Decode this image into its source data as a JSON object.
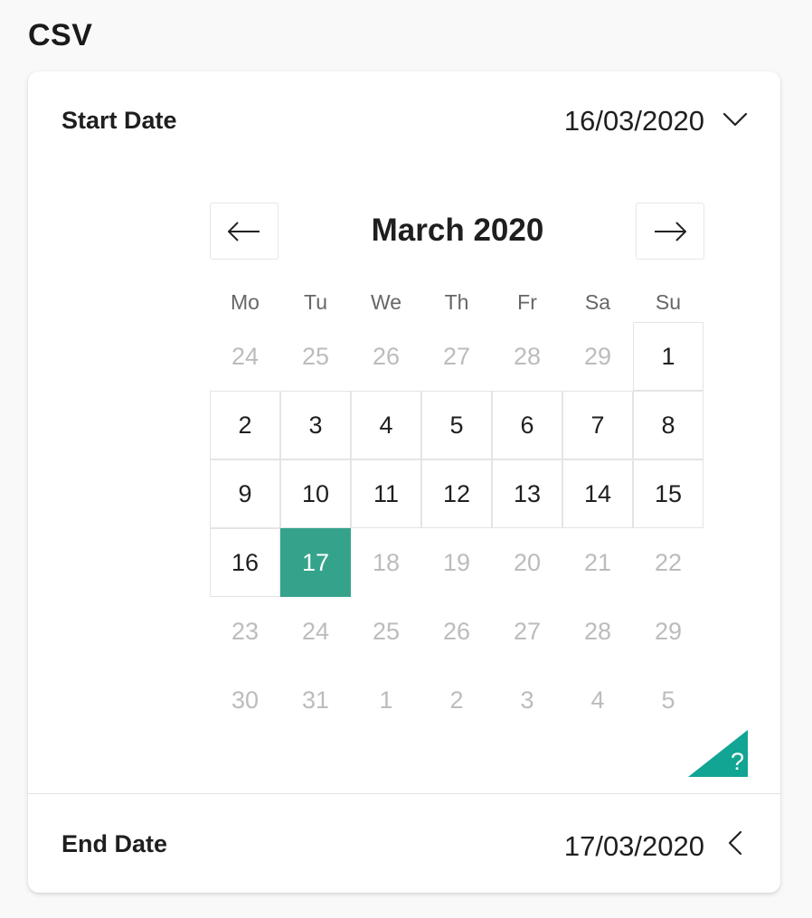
{
  "page": {
    "title": "CSV"
  },
  "start_date": {
    "label": "Start Date",
    "value": "16/03/2020"
  },
  "end_date": {
    "label": "End Date",
    "value": "17/03/2020"
  },
  "calendar": {
    "month_label": "March 2020",
    "weekdays": [
      "Mo",
      "Tu",
      "We",
      "Th",
      "Fr",
      "Sa",
      "Su"
    ],
    "days": [
      {
        "label": "24",
        "muted": true
      },
      {
        "label": "25",
        "muted": true
      },
      {
        "label": "26",
        "muted": true
      },
      {
        "label": "27",
        "muted": true
      },
      {
        "label": "28",
        "muted": true
      },
      {
        "label": "29",
        "muted": true
      },
      {
        "label": "1",
        "muted": false,
        "bordered": true
      },
      {
        "label": "2",
        "muted": false,
        "bordered": true
      },
      {
        "label": "3",
        "muted": false,
        "bordered": true
      },
      {
        "label": "4",
        "muted": false,
        "bordered": true
      },
      {
        "label": "5",
        "muted": false,
        "bordered": true
      },
      {
        "label": "6",
        "muted": false,
        "bordered": true
      },
      {
        "label": "7",
        "muted": false,
        "bordered": true
      },
      {
        "label": "8",
        "muted": false,
        "bordered": true
      },
      {
        "label": "9",
        "muted": false,
        "bordered": true
      },
      {
        "label": "10",
        "muted": false,
        "bordered": true
      },
      {
        "label": "11",
        "muted": false,
        "bordered": true
      },
      {
        "label": "12",
        "muted": false,
        "bordered": true
      },
      {
        "label": "13",
        "muted": false,
        "bordered": true
      },
      {
        "label": "14",
        "muted": false,
        "bordered": true
      },
      {
        "label": "15",
        "muted": false,
        "bordered": true
      },
      {
        "label": "16",
        "muted": false,
        "bordered": true
      },
      {
        "label": "17",
        "muted": false,
        "selected": true
      },
      {
        "label": "18",
        "muted": true
      },
      {
        "label": "19",
        "muted": true
      },
      {
        "label": "20",
        "muted": true
      },
      {
        "label": "21",
        "muted": true
      },
      {
        "label": "22",
        "muted": true
      },
      {
        "label": "23",
        "muted": true
      },
      {
        "label": "24",
        "muted": true
      },
      {
        "label": "25",
        "muted": true
      },
      {
        "label": "26",
        "muted": true
      },
      {
        "label": "27",
        "muted": true
      },
      {
        "label": "28",
        "muted": true
      },
      {
        "label": "29",
        "muted": true
      },
      {
        "label": "30",
        "muted": true
      },
      {
        "label": "31",
        "muted": true
      },
      {
        "label": "1",
        "muted": true
      },
      {
        "label": "2",
        "muted": true
      },
      {
        "label": "3",
        "muted": true
      },
      {
        "label": "4",
        "muted": true
      },
      {
        "label": "5",
        "muted": true
      }
    ]
  },
  "help": {
    "label": "?",
    "icon": "question-icon"
  },
  "colors": {
    "accent": "#35a38b",
    "help_badge": "#12a594",
    "muted_text": "#bcbcbc"
  }
}
